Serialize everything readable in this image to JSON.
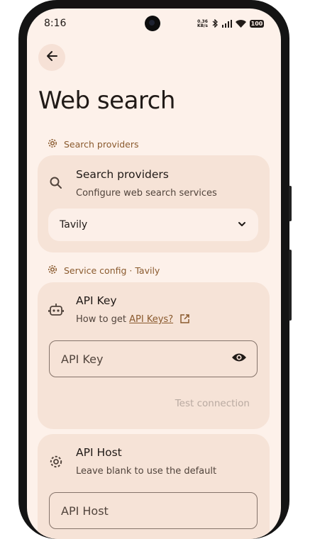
{
  "status": {
    "time": "8:16",
    "net_speed_value": "0.36",
    "net_speed_unit": "KB/s",
    "battery": "100"
  },
  "page": {
    "title": "Web search"
  },
  "providers_section": {
    "label": "Search providers",
    "card": {
      "title": "Search providers",
      "subtitle": "Configure web search services",
      "selected": "Tavily"
    }
  },
  "config_section": {
    "label": "Service config · Tavily",
    "api_key_card": {
      "title": "API Key",
      "help_prefix": "How to get ",
      "help_link": "API Keys?",
      "input_placeholder": "API Key",
      "test_button": "Test connection"
    },
    "api_host_card": {
      "title": "API Host",
      "subtitle": "Leave blank to use the default",
      "input_placeholder": "API Host"
    }
  },
  "colors": {
    "background": "#fdf1ea",
    "card": "#f6e3d7",
    "accent": "#8a5a2e",
    "text": "#201a17"
  }
}
